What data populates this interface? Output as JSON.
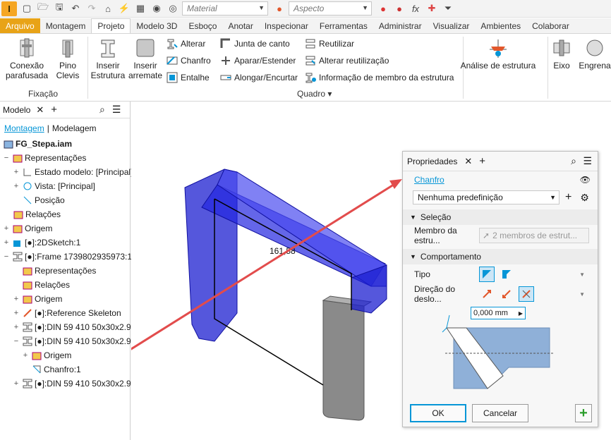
{
  "qa": {
    "logo": "I",
    "material": "Material",
    "aspecto": "Aspecto"
  },
  "tabs": [
    "Arquivo",
    "Montagem",
    "Projeto",
    "Modelo 3D",
    "Esboço",
    "Anotar",
    "Inspecionar",
    "Ferramentas",
    "Administrar",
    "Visualizar",
    "Ambientes",
    "Colaborar"
  ],
  "ribbon": {
    "conexao": "Conexão\nparafusada",
    "pino": "Pino\nClevis",
    "inserir_estrutura": "Inserir\nEstrutura",
    "inserir_arremate": "Inserir\narremate",
    "alterar": "Alterar",
    "chanfro": "Chanfro",
    "entalhe": "Entalhe",
    "junta": "Junta de canto",
    "aparar": "Aparar/Estender",
    "alongar": "Alongar/Encurtar",
    "reutilizar": "Reutilizar",
    "alterar_reut": "Alterar reutilização",
    "info_membro": "Informação de membro da estrutura",
    "analise": "Análise de estrutura",
    "eixo": "Eixo",
    "engrena": "Engrena",
    "fixacao": "Fixação",
    "quadro": "Quadro"
  },
  "browser": {
    "title": "Modelo",
    "tab_montagem": "Montagem",
    "tab_modelagem": "Modelagem",
    "items": [
      {
        "label": "FG_Stepa.iam"
      },
      {
        "label": "Representações"
      },
      {
        "label": "Estado modelo: [Principal]"
      },
      {
        "label": "Vista: [Principal]"
      },
      {
        "label": "Posição"
      },
      {
        "label": "Relações"
      },
      {
        "label": "Origem"
      },
      {
        "label": "[●]:2DSketch:1"
      },
      {
        "label": "[●]:Frame 1739802935973:1"
      },
      {
        "label": "Representações"
      },
      {
        "label": "Relações"
      },
      {
        "label": "Origem"
      },
      {
        "label": "[●]:Reference Skeleton"
      },
      {
        "label": "[●]:DIN 59 410 50x30x2.9"
      },
      {
        "label": "[●]:DIN 59 410 50x30x2.9"
      },
      {
        "label": "Origem"
      },
      {
        "label": "Chanfro:1"
      },
      {
        "label": "[●]:DIN 59 410 50x30x2.9"
      }
    ]
  },
  "viewport": {
    "dimension": "161,58"
  },
  "panel": {
    "title": "Propriedades",
    "feature": "Chanfro",
    "preset": "Nenhuma predefinição",
    "sec_selecao": "Seleção",
    "membro_label": "Membro da estru...",
    "membro_value": "2 membros de estrut...",
    "sec_comport": "Comportamento",
    "tipo_label": "Tipo",
    "direcao_label": "Direção do deslo...",
    "dim_value": "0,000 mm",
    "ok": "OK",
    "cancel": "Cancelar"
  },
  "colors": {
    "accent": "#0696d7",
    "file_tab": "#e8a317",
    "frame_blue": "#1c1fd0",
    "arrow": "#e24c4c"
  }
}
